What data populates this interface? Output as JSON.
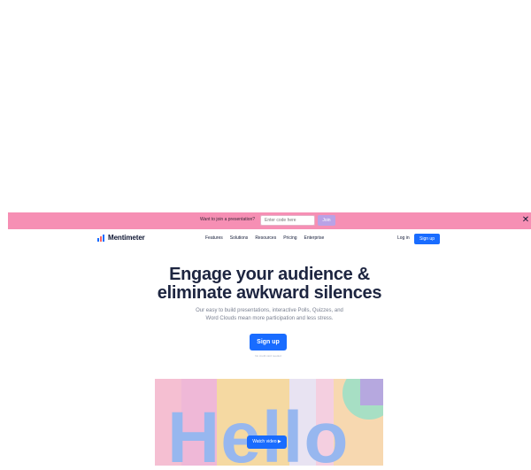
{
  "banner": {
    "prompt": "Want to join a presentation?",
    "code_placeholder": "Enter code here",
    "submit_label": "Join",
    "close_glyph": "✕"
  },
  "nav": {
    "brand": "Mentimeter",
    "links": [
      "Features",
      "Solutions",
      "Resources",
      "Pricing",
      "Enterprise"
    ],
    "login_label": "Log in",
    "signup_label": "Sign up"
  },
  "hero": {
    "title_line1": "Engage your audience &",
    "title_line2": "eliminate awkward silences",
    "subtitle_line1": "Our easy to build presentations, interactive Polls, Quizzes, and",
    "subtitle_line2": "Word Clouds mean more participation and less stress.",
    "cta_label": "Sign up",
    "cta_note": "No credit card needed",
    "image_word": "Hello",
    "watch_label": "Watch video ▶"
  },
  "colors": {
    "banner": "#f68fb4",
    "accent": "#196cff",
    "title": "#1d2540"
  }
}
